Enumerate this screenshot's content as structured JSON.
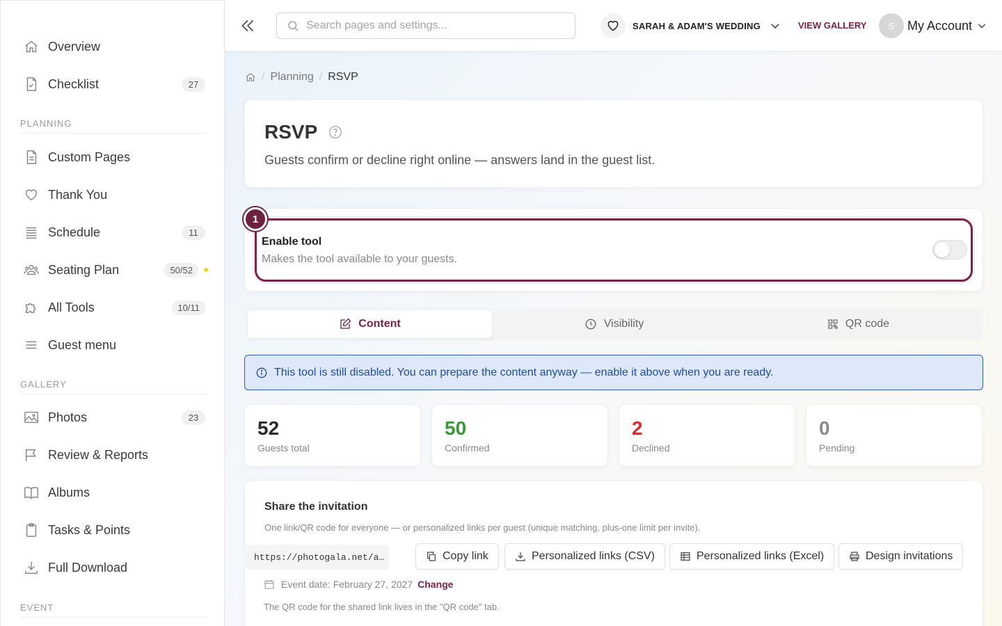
{
  "sidebar": {
    "items": [
      {
        "label": "Overview",
        "icon": "home-icon"
      },
      {
        "label": "Checklist",
        "icon": "checklist-icon",
        "badge": "27"
      },
      {
        "label": "Custom Pages",
        "icon": "file-icon"
      },
      {
        "label": "Thank You",
        "icon": "heart-icon"
      },
      {
        "label": "Schedule",
        "icon": "schedule-icon",
        "badge": "11"
      },
      {
        "label": "Seating Plan",
        "icon": "people-icon",
        "badge": "50/52"
      },
      {
        "label": "All Tools",
        "icon": "puzzle-icon",
        "badge": "10/11"
      },
      {
        "label": "Guest menu",
        "icon": "menu-icon"
      },
      {
        "label": "Photos",
        "icon": "image-icon",
        "badge": "23"
      },
      {
        "label": "Review & Reports",
        "icon": "flag-icon"
      },
      {
        "label": "Albums",
        "icon": "book-icon"
      },
      {
        "label": "Tasks & Points",
        "icon": "clipboard-icon"
      },
      {
        "label": "Full Download",
        "icon": "download-icon"
      }
    ],
    "sections": {
      "planning": "PLANNING",
      "gallery": "GALLERY",
      "event": "EVENT"
    }
  },
  "topbar": {
    "search_placeholder": "Search pages and settings...",
    "event_name": "SARAH & ADAM'S WEDDING",
    "view_gallery": "VIEW GALLERY",
    "avatar_initial": "S",
    "account_label": "My Account"
  },
  "breadcrumb": {
    "parent": "Planning",
    "current": "RSVP"
  },
  "header": {
    "title": "RSVP",
    "description": "Guests confirm or decline right online — answers land in the guest list."
  },
  "enable_tool": {
    "step": "1",
    "title": "Enable tool",
    "description": "Makes the tool available to your guests.",
    "enabled": false
  },
  "tabs": [
    {
      "label": "Content",
      "icon": "edit-icon",
      "active": true
    },
    {
      "label": "Visibility",
      "icon": "clock-icon",
      "active": false
    },
    {
      "label": "QR code",
      "icon": "qr-icon",
      "active": false
    }
  ],
  "alert": {
    "text": "This tool is still disabled. You can prepare the content anyway — enable it above when you are ready."
  },
  "stats": [
    {
      "value": "52",
      "label": "Guests total",
      "color": "#2b2b2b"
    },
    {
      "value": "50",
      "label": "Confirmed",
      "color": "#3a9a3a"
    },
    {
      "value": "2",
      "label": "Declined",
      "color": "#d33030"
    },
    {
      "value": "0",
      "label": "Pending",
      "color": "#8a8a8a"
    }
  ],
  "share": {
    "title": "Share the invitation",
    "subtitle": "One link/QR code for everyone — or personalized links per guest (unique matching, plus-one limit per invite).",
    "link": "https://photogala.net/a…",
    "copy_link": "Copy link",
    "csv": "Personalized links (CSV)",
    "excel": "Personalized links (Excel)",
    "design": "Design invitations",
    "event_date": "Event date: February 27, 2027",
    "change": "Change",
    "qr_note": "The QR code for the shared link lives in the \"QR code\" tab."
  },
  "colors": {
    "accent": "#7b2346",
    "info": "#1f4aa0",
    "info_bg": "#dde9fa"
  }
}
